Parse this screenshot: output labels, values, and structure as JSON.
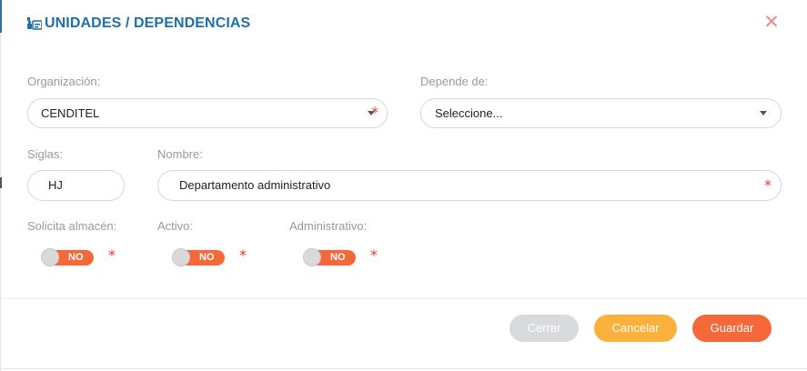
{
  "header": {
    "title": "UNIDADES / DEPENDENCIAS",
    "icon": "organization-icon",
    "close_symbol": "✕"
  },
  "form": {
    "organizacion": {
      "label": "Organización:",
      "value": "CENDITEL",
      "required": true
    },
    "depende_de": {
      "label": "Depende de:",
      "value": "Seleccione..."
    },
    "siglas": {
      "label": "Siglas:",
      "value": "HJ"
    },
    "nombre": {
      "label": "Nombre:",
      "value": "Departamento administrativo",
      "required": true
    },
    "solicita_almacen": {
      "label": "Solicita almacén:",
      "state": "NO",
      "required": true
    },
    "activo": {
      "label": "Activo:",
      "state": "NO",
      "required": true
    },
    "administrativo": {
      "label": "Administrativo:",
      "state": "NO",
      "required": true
    },
    "required_mark": "*"
  },
  "footer": {
    "close_label": "Cerrar",
    "cancel_label": "Cancelar",
    "save_label": "Guardar"
  },
  "colors": {
    "title": "#1f6fa8",
    "toggle_off": "#f4683a",
    "cancel": "#fbb13c",
    "save": "#f4683a",
    "close": "#d7dbde",
    "required": "#e53935"
  }
}
